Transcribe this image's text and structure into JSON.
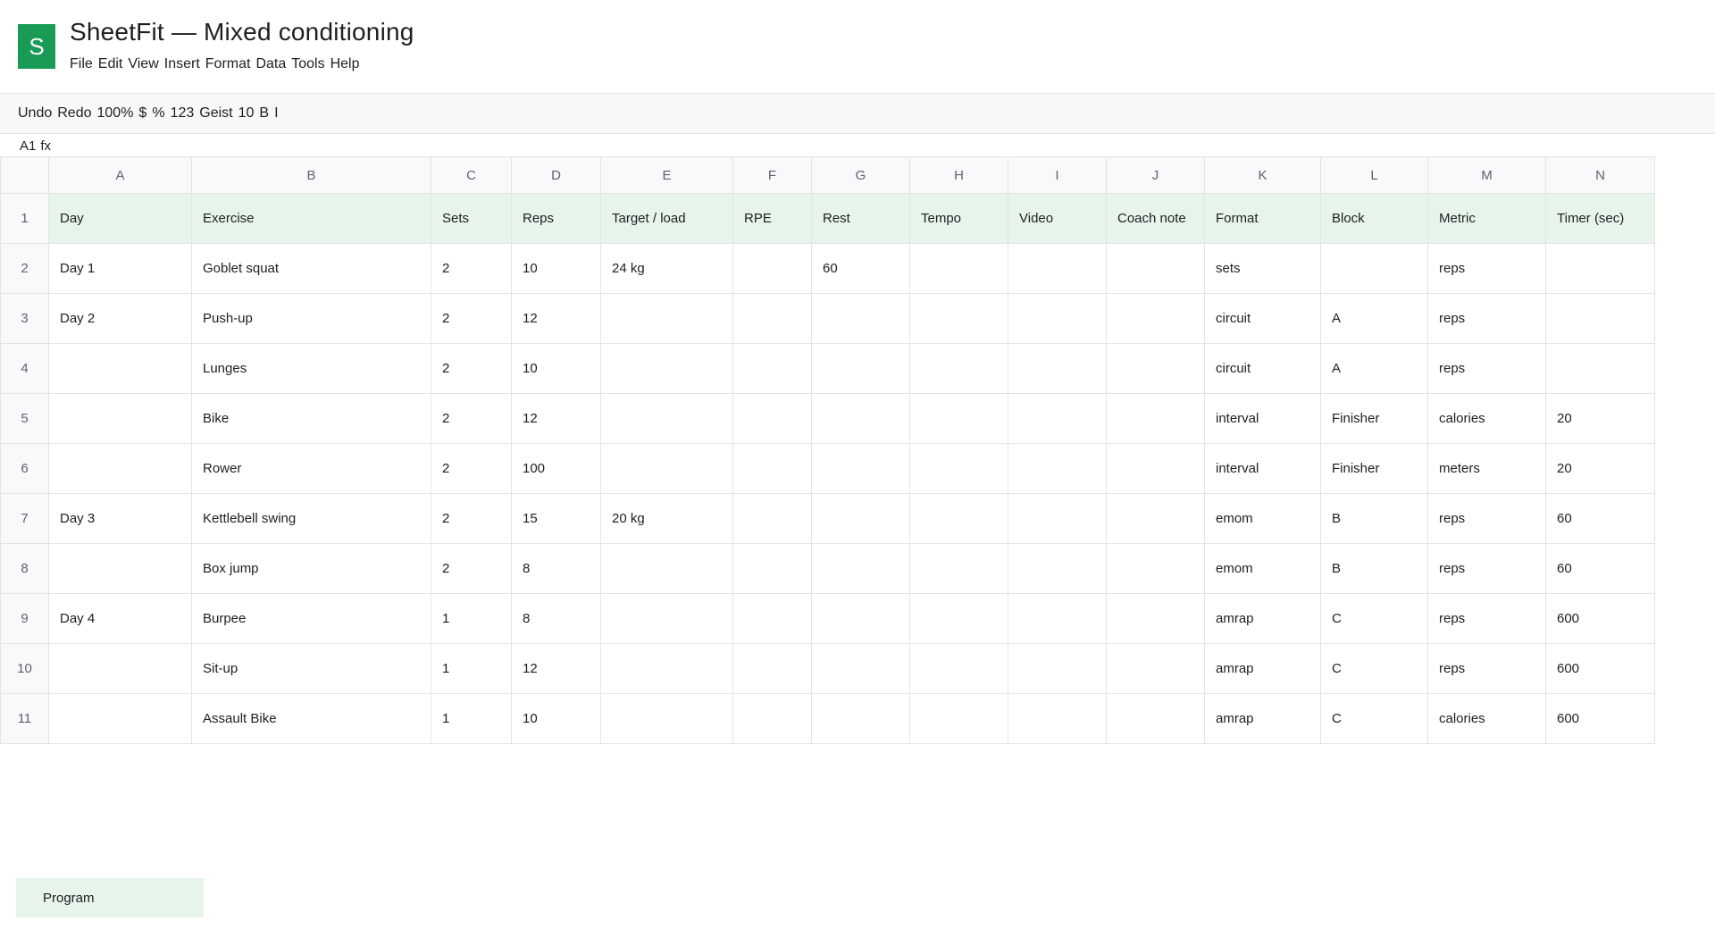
{
  "app": {
    "logo_letter": "S",
    "title": "SheetFit — Mixed conditioning"
  },
  "menu": [
    "File",
    "Edit",
    "View",
    "Insert",
    "Format",
    "Data",
    "Tools",
    "Help"
  ],
  "toolbar": [
    "Undo",
    "Redo",
    "100%",
    "$",
    "%",
    "123",
    "Geist",
    "10",
    "B",
    "I"
  ],
  "formula_bar": {
    "cell_ref": "A1",
    "fx_label": "fx"
  },
  "columns": [
    "A",
    "B",
    "C",
    "D",
    "E",
    "F",
    "G",
    "H",
    "I",
    "J",
    "K",
    "L",
    "M",
    "N"
  ],
  "rows": [
    [
      "Day",
      "Exercise",
      "Sets",
      "Reps",
      "Target / load",
      "RPE",
      "Rest",
      "Tempo",
      "Video",
      "Coach note",
      "Format",
      "Block",
      "Metric",
      "Timer (sec)"
    ],
    [
      "Day 1",
      "Goblet squat",
      "2",
      "10",
      "24 kg",
      "",
      "60",
      "",
      "",
      "",
      "sets",
      "",
      "reps",
      ""
    ],
    [
      "Day 2",
      "Push-up",
      "2",
      "12",
      "",
      "",
      "",
      "",
      "",
      "",
      "circuit",
      "A",
      "reps",
      ""
    ],
    [
      "",
      "Lunges",
      "2",
      "10",
      "",
      "",
      "",
      "",
      "",
      "",
      "circuit",
      "A",
      "reps",
      ""
    ],
    [
      "",
      "Bike",
      "2",
      "12",
      "",
      "",
      "",
      "",
      "",
      "",
      "interval",
      "Finisher",
      "calories",
      "20"
    ],
    [
      "",
      "Rower",
      "2",
      "100",
      "",
      "",
      "",
      "",
      "",
      "",
      "interval",
      "Finisher",
      "meters",
      "20"
    ],
    [
      "Day 3",
      "Kettlebell swing",
      "2",
      "15",
      "20 kg",
      "",
      "",
      "",
      "",
      "",
      "emom",
      "B",
      "reps",
      "60"
    ],
    [
      "",
      "Box jump",
      "2",
      "8",
      "",
      "",
      "",
      "",
      "",
      "",
      "emom",
      "B",
      "reps",
      "60"
    ],
    [
      "Day 4",
      "Burpee",
      "1",
      "8",
      "",
      "",
      "",
      "",
      "",
      "",
      "amrap",
      "C",
      "reps",
      "600"
    ],
    [
      "",
      "Sit-up",
      "1",
      "12",
      "",
      "",
      "",
      "",
      "",
      "",
      "amrap",
      "C",
      "reps",
      "600"
    ],
    [
      "",
      "Assault Bike",
      "1",
      "10",
      "",
      "",
      "",
      "",
      "",
      "",
      "amrap",
      "C",
      "calories",
      "600"
    ]
  ],
  "sheet_tabs": [
    {
      "label": "Program",
      "active": true
    }
  ],
  "colors": {
    "brand": "#1a9b55",
    "header_row_fill": "#e6f4ea",
    "active_tab_fill": "#e6f4ea"
  }
}
